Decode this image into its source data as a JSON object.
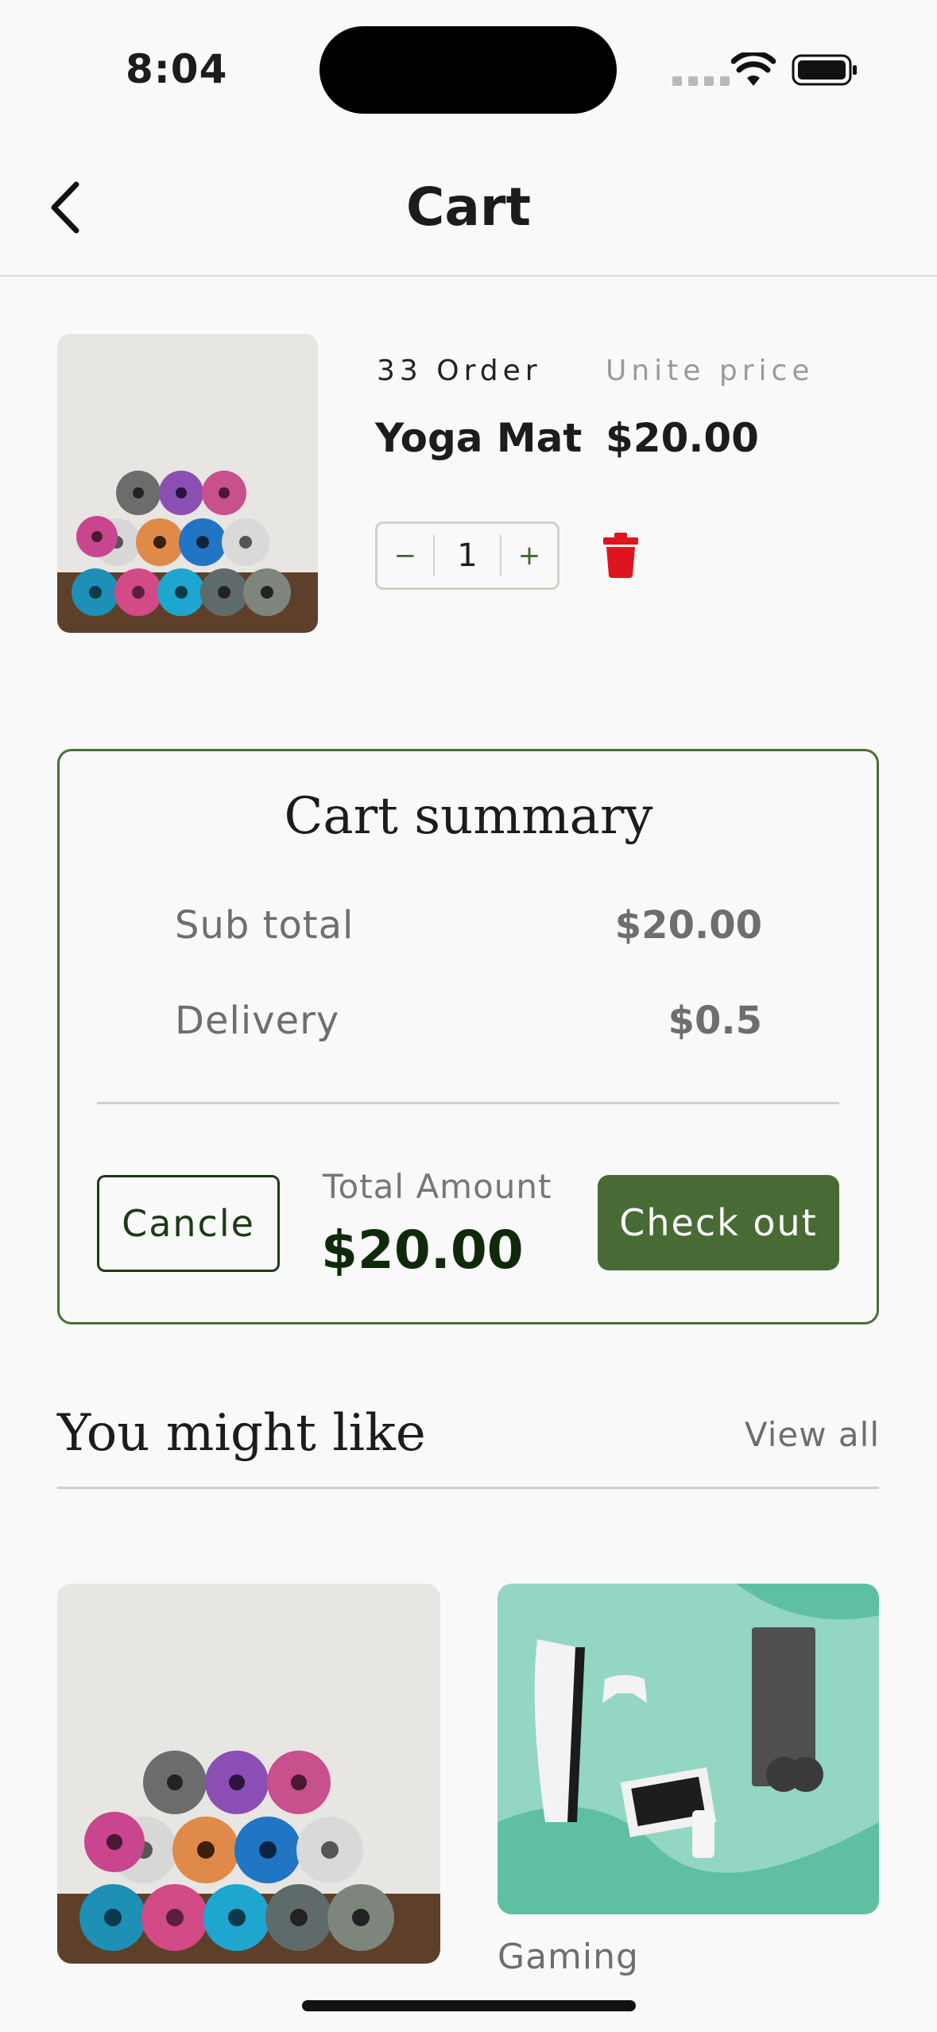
{
  "status_bar": {
    "time": "8:04"
  },
  "header": {
    "title": "Cart"
  },
  "cart_item": {
    "order_label": "33 Order",
    "unit_price_label": "Unite price",
    "name": "Yoga Mat",
    "price": "$20.00",
    "quantity": "1",
    "minus": "−",
    "plus": "+"
  },
  "summary": {
    "title": "Cart summary",
    "subtotal_label": "Sub total",
    "subtotal_value": "$20.00",
    "delivery_label": "Delivery",
    "delivery_value": "$0.5",
    "cancel_label": "Cancle",
    "total_label": "Total Amount",
    "total_value": "$20.00",
    "checkout_label": "Check out"
  },
  "recommend": {
    "title": "You might like",
    "view_all": "View all",
    "items": [
      {
        "image": "yoga-mats-image"
      },
      {
        "image": "gaming-consoles-image",
        "label": "Gaming"
      }
    ]
  },
  "colors": {
    "accent": "#486b35",
    "delete": "#e0141e",
    "border": "#4a6f38"
  }
}
